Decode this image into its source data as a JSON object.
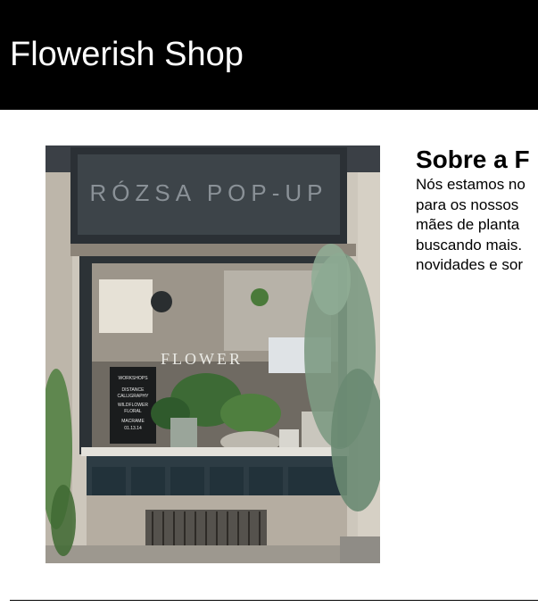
{
  "header": {
    "title": "Flowerish Shop",
    "background": "#000000",
    "text_color": "#ffffff"
  },
  "shop_photo": {
    "storefront_sign": "RÓZSA POP-UP",
    "window_logo": "FLOWER",
    "chalkboard_lines": [
      "WORKSHOPS",
      "DISTANCE",
      "CALLIGRAPHY",
      "WILDFLOWER",
      "FLORAL",
      "MACRAME",
      "01.13.14"
    ]
  },
  "about": {
    "title": "Sobre a F",
    "lines": [
      "Nós estamos no",
      "para os nossos",
      "mães de planta",
      "buscando mais.",
      "novidades e sor"
    ]
  }
}
